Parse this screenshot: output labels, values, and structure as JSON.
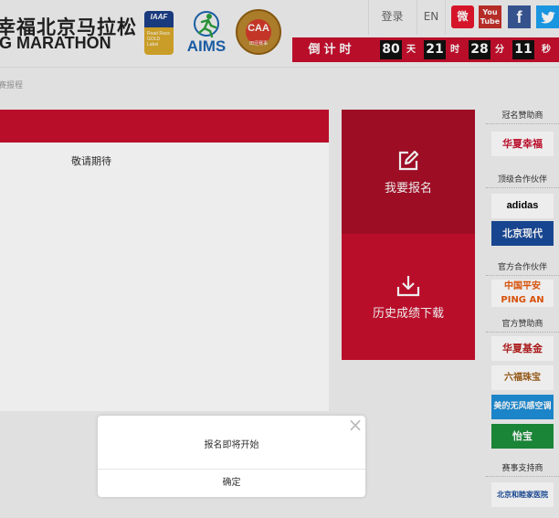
{
  "header": {
    "brand_cn": "幸福北京马拉松",
    "brand_en": "IG MARATHON",
    "logos": {
      "iaaf": {
        "title": "IAAF",
        "subtitle": "Road Race GOLD Label"
      },
      "aims": {
        "title": "AIMS"
      },
      "caa": {
        "title": "CAA",
        "subtitle": "田径赛事"
      }
    },
    "login": "登录",
    "lang": "EN",
    "social": {
      "weibo": "微",
      "youtube": "You Tube",
      "facebook": "f",
      "twitter": "🐦"
    },
    "countdown": {
      "label": "倒计时",
      "days": "80",
      "days_unit": "天",
      "hours": "21",
      "hours_unit": "时",
      "minutes": "28",
      "minutes_unit": "分",
      "seconds": "11",
      "seconds_unit": "秒"
    }
  },
  "breadcrumb": "赛报程",
  "content": {
    "message": "敬请期待"
  },
  "actions": {
    "signup": "我要报名",
    "results": "历史成绩下载"
  },
  "sponsors": {
    "title_sponsor": {
      "heading": "冠名赞助商",
      "logos": [
        "华夏幸福"
      ]
    },
    "top_partners": {
      "heading": "顶级合作伙伴",
      "logos": [
        "adidas",
        "北京现代"
      ]
    },
    "official_partners": {
      "heading": "官方合作伙伴",
      "logos": [
        "中国平安 PING AN"
      ]
    },
    "official_sponsors": {
      "heading": "官方赞助商",
      "logos": [
        "华夏基金",
        "六福珠宝",
        "美的无风感空调",
        "怡宝"
      ]
    },
    "supporters": {
      "heading": "赛事支持商",
      "logos": [
        "北京和睦家医院"
      ]
    }
  },
  "modal": {
    "message": "报名即将开始",
    "ok_label": "确定",
    "close_icon": "×"
  },
  "colors": {
    "brand_red": "#c8102e",
    "dark_red": "#a90e27"
  }
}
